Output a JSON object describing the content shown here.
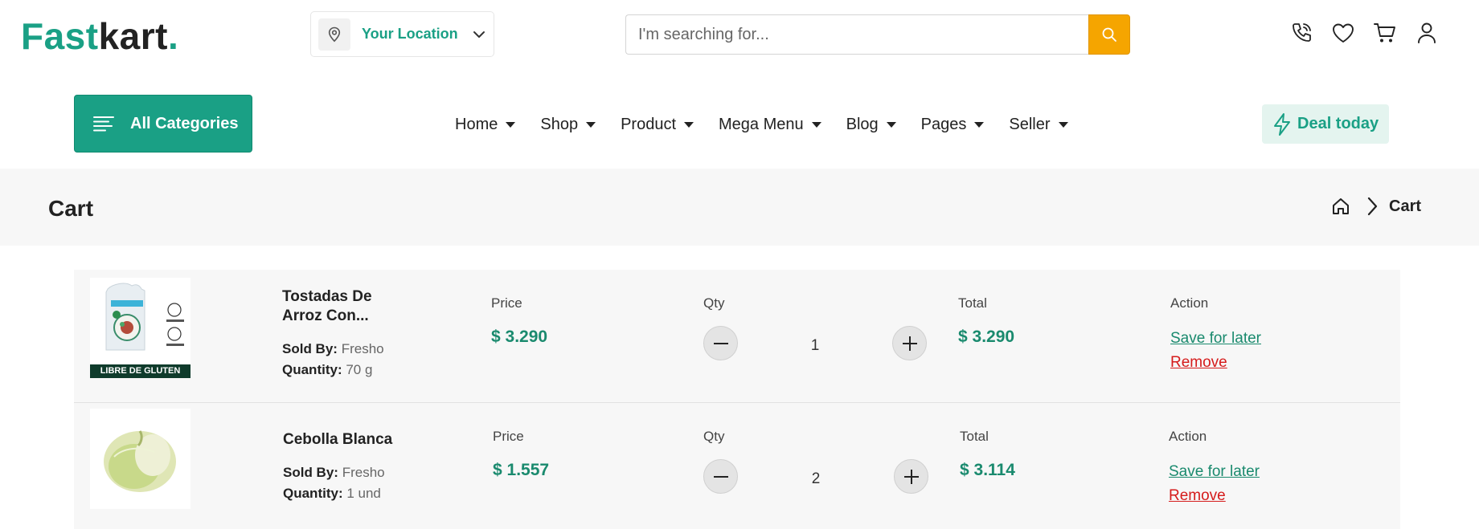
{
  "header": {
    "logo": {
      "part1": "Fast",
      "part2": "kart",
      "dot": "."
    },
    "location_label": "Your Location",
    "search_placeholder": "I'm searching for...",
    "icons": [
      "phone-icon",
      "heart-icon",
      "cart-icon",
      "user-icon"
    ]
  },
  "nav": {
    "all_categories": "All Categories",
    "items": [
      {
        "label": "Home"
      },
      {
        "label": "Shop"
      },
      {
        "label": "Product"
      },
      {
        "label": "Mega Menu"
      },
      {
        "label": "Blog"
      },
      {
        "label": "Pages"
      },
      {
        "label": "Seller"
      }
    ],
    "deal": "Deal today"
  },
  "page": {
    "title": "Cart",
    "breadcrumb_current": "Cart"
  },
  "cart": {
    "labels": {
      "price": "Price",
      "qty": "Qty",
      "total": "Total",
      "action": "Action",
      "sold_by": "Sold By:",
      "quantity": "Quantity:",
      "save_for_later": "Save for later",
      "remove": "Remove",
      "minus": "−",
      "plus": "+"
    },
    "items": [
      {
        "name_line1": "Tostadas De",
        "name_line2": "Arroz Con...",
        "sold_by": "Fresho",
        "quantity": "70 g",
        "price": "$ 3.290",
        "qty": "1",
        "total": "$ 3.290",
        "image_caption": "LIBRE DE GLUTEN"
      },
      {
        "name_line1": "Cebolla Blanca",
        "sold_by": "Fresho",
        "quantity": "1 und",
        "price": "$ 1.557",
        "qty": "2",
        "total": "$ 3.114"
      }
    ]
  },
  "colors": {
    "brand": "#1aa085",
    "search_button": "#f5a500",
    "remove": "#d51b1b",
    "deal_bg": "#e4f4ef"
  }
}
